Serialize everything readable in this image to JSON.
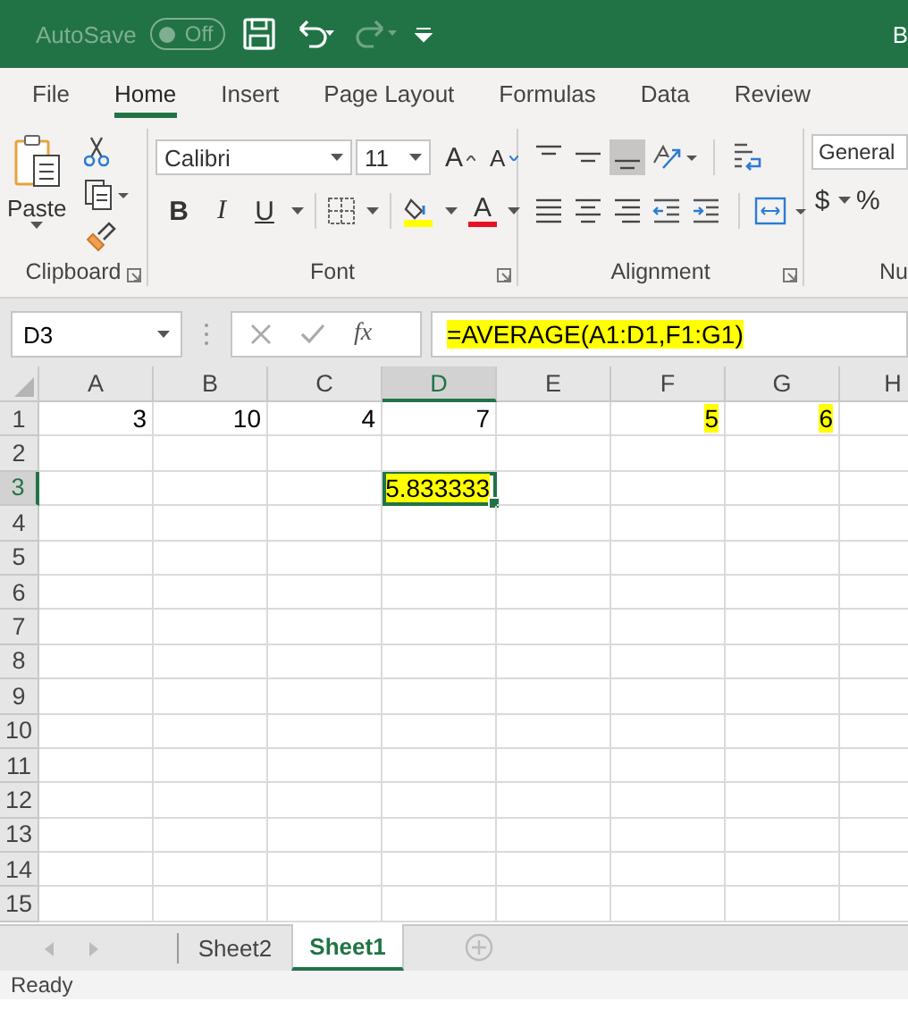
{
  "title_bar": {
    "autosave_label": "AutoSave",
    "autosave_toggle": "Off",
    "autosave_on": false,
    "title": "B"
  },
  "ribbon_tabs": [
    {
      "label": "File",
      "selected": false
    },
    {
      "label": "Home",
      "selected": true
    },
    {
      "label": "Insert",
      "selected": false
    },
    {
      "label": "Page Layout",
      "selected": false
    },
    {
      "label": "Formulas",
      "selected": false
    },
    {
      "label": "Data",
      "selected": false
    },
    {
      "label": "Review",
      "selected": false
    }
  ],
  "ribbon": {
    "paste_label": "Paste",
    "font_name": "Calibri",
    "font_size": "11",
    "font_grow": "A",
    "font_shrink": "A",
    "format_buttons": [
      "B",
      "I",
      "U"
    ],
    "font_color": "A",
    "number_format": "General",
    "currency": "$",
    "percent": "%",
    "groups": [
      "Clipboard",
      "Font",
      "Alignment",
      "Nu"
    ]
  },
  "formula_bar": {
    "name_box": "D3",
    "fx": "fx",
    "formula": "=AVERAGE(A1:D1,F1:G1)",
    "highlighted": true
  },
  "sheet": {
    "columns": [
      {
        "label": "A",
        "selected": false
      },
      {
        "label": "B",
        "selected": false
      },
      {
        "label": "C",
        "selected": false
      },
      {
        "label": "D",
        "selected": true
      },
      {
        "label": "E",
        "selected": false
      },
      {
        "label": "F",
        "selected": false
      },
      {
        "label": "G",
        "selected": false
      },
      {
        "label": "H",
        "selected": false
      }
    ],
    "rows": [
      {
        "label": "1",
        "selected": false,
        "cells": [
          {
            "text": "3",
            "highlighted": false,
            "selected": false
          },
          {
            "text": "10",
            "highlighted": false,
            "selected": false
          },
          {
            "text": "4",
            "highlighted": false,
            "selected": false
          },
          {
            "text": "7",
            "highlighted": false,
            "selected": false
          },
          {
            "highlighted": false,
            "selected": false
          },
          {
            "text": "5",
            "highlighted": true,
            "selected": false
          },
          {
            "text": "6",
            "highlighted": true,
            "selected": false
          },
          {
            "highlighted": false,
            "selected": false
          }
        ]
      },
      {
        "label": "2",
        "selected": false
      },
      {
        "label": "3",
        "selected": true,
        "cells": [
          {
            "highlighted": false,
            "selected": false
          },
          {
            "highlighted": false,
            "selected": false
          },
          {
            "highlighted": false,
            "selected": false
          },
          {
            "text": "5.833333",
            "highlighted": true,
            "selected": true
          },
          {
            "highlighted": false,
            "selected": false
          },
          {
            "highlighted": false,
            "selected": false
          },
          {
            "highlighted": false,
            "selected": false
          },
          {
            "highlighted": false,
            "selected": false
          }
        ]
      },
      {
        "label": "4",
        "selected": false
      },
      {
        "label": "5",
        "selected": false
      },
      {
        "label": "6",
        "selected": false
      },
      {
        "label": "7",
        "selected": false
      },
      {
        "label": "8",
        "selected": false
      },
      {
        "label": "9",
        "selected": false
      },
      {
        "label": "10",
        "selected": false
      },
      {
        "label": "11",
        "selected": false
      },
      {
        "label": "12",
        "selected": false
      },
      {
        "label": "13",
        "selected": false
      },
      {
        "label": "14",
        "selected": false
      },
      {
        "label": "15",
        "selected": false
      }
    ]
  },
  "sheet_tabs": [
    {
      "label": "Sheet2",
      "selected": false
    },
    {
      "label": "Sheet1",
      "selected": true
    }
  ],
  "status_bar": {
    "text": "Ready"
  }
}
